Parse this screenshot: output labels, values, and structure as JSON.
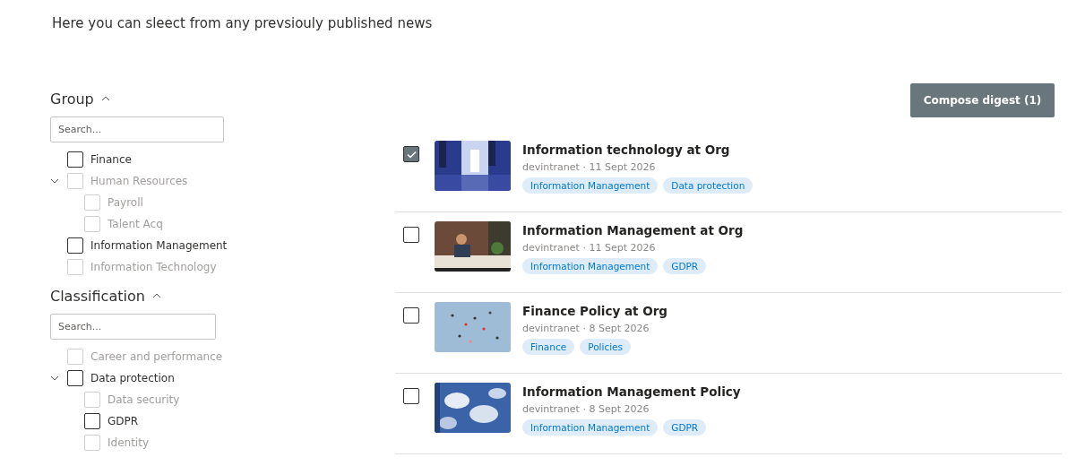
{
  "intro": "Here you can sleect from any prevsiouly published news",
  "filters": [
    {
      "title": "Group",
      "expanded": true,
      "search": {
        "placeholder": "Search..."
      },
      "items": [
        {
          "label": "Finance",
          "checked": false,
          "disabled": false
        },
        {
          "label": "Human Resources",
          "checked": false,
          "disabled": true,
          "expanded": true,
          "children": [
            {
              "label": "Payroll",
              "checked": false,
              "disabled": true
            },
            {
              "label": "Talent Acq",
              "checked": false,
              "disabled": true
            }
          ]
        },
        {
          "label": "Information Management",
          "checked": false,
          "disabled": false
        },
        {
          "label": "Information Technology",
          "checked": false,
          "disabled": true
        }
      ]
    },
    {
      "title": "Classification",
      "expanded": true,
      "search": {
        "placeholder": "Search..."
      },
      "items": [
        {
          "label": "Career and performance",
          "checked": false,
          "disabled": true
        },
        {
          "label": "Data protection",
          "checked": false,
          "disabled": false,
          "expanded": true,
          "children": [
            {
              "label": "Data security",
              "checked": false,
              "disabled": true
            },
            {
              "label": "GDPR",
              "checked": false,
              "disabled": false
            },
            {
              "label": "Identity",
              "checked": false,
              "disabled": true
            }
          ]
        }
      ]
    }
  ],
  "compose_button": "Compose digest (1)",
  "news": [
    {
      "title": "Information technology at Org",
      "meta": "devintranet · 11 Sept 2026",
      "selected": true,
      "tags": [
        "Information Management",
        "Data protection"
      ]
    },
    {
      "title": "Information Management at Org",
      "meta": "devintranet · 11 Sept 2026",
      "selected": false,
      "tags": [
        "Information Management",
        "GDPR"
      ]
    },
    {
      "title": "Finance Policy at Org",
      "meta": "devintranet · 8 Sept 2026",
      "selected": false,
      "tags": [
        "Finance",
        "Policies"
      ]
    },
    {
      "title": "Information Management Policy",
      "meta": "devintranet · 8 Sept 2026",
      "selected": false,
      "tags": [
        "Information Management",
        "GDPR"
      ]
    }
  ]
}
